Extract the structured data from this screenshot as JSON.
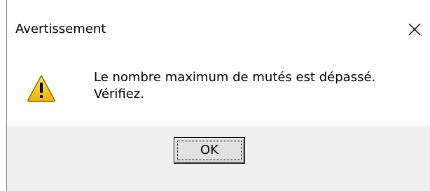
{
  "dialog": {
    "title": "Avertissement",
    "close_icon": "close-icon",
    "message_line1": "Le nombre maximum de mutés est dépassé.",
    "message_line2": "Vérifiez.",
    "icon": "warning-icon",
    "ok_label": "OK"
  },
  "colors": {
    "footer_bg": "#f0f0f0",
    "warning_yellow": "#f5c400",
    "warning_border": "#8a6d00"
  }
}
